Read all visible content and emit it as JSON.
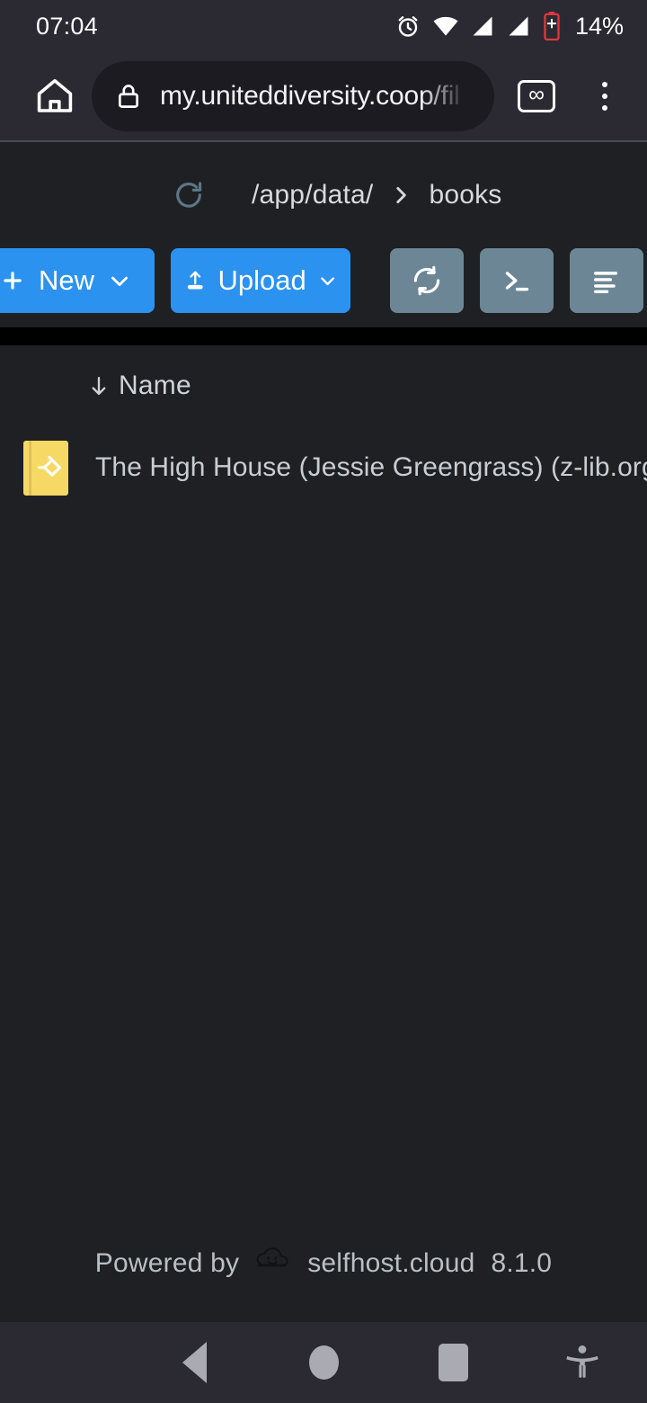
{
  "status_bar": {
    "clock": "07:04",
    "battery_percent": "14%",
    "battery_color": "#e8373c",
    "icons": [
      "alarm-clock-icon",
      "wifi-icon",
      "signal-bar-icon",
      "signal-bar-icon",
      "battery-low-icon"
    ]
  },
  "browser": {
    "home_icon": "home-icon",
    "security_icon": "lock-icon",
    "url": "my.uniteddiversity.coop/fil",
    "tab_count_label": "∞",
    "menu_icon": "more-vertical-icon"
  },
  "breadcrumb": {
    "reload_icon": "reload-icon",
    "reload_color": "#5b7786",
    "items": [
      "/app/data/",
      "books"
    ],
    "separator": "›"
  },
  "toolbar": {
    "new_label": "New",
    "new_icon": "plus-icon",
    "new_caret": "chevron-down-icon",
    "upload_label": "Upload",
    "upload_icon": "upload-icon",
    "upload_caret": "chevron-down-icon",
    "sync_icon": "sync-icon",
    "terminal_icon": "terminal-icon",
    "list_icon": "list-menu-icon",
    "accent_color": "#2b92f0",
    "secondary_color": "#6c8695"
  },
  "file_list": {
    "sort_column_label": "Name",
    "sort_direction_icon": "arrow-down-icon",
    "rows": [
      {
        "name": "The High House (Jessie Greengrass) (z-lib.org",
        "file_icon": "epub-book-icon",
        "icon_color": "#f6d964"
      }
    ]
  },
  "footer": {
    "prefix": "Powered by",
    "logo_icon": "cloud-smile-icon",
    "product": "selfhost.cloud",
    "version": "8.1.0"
  },
  "nav_bar": {
    "back_icon": "triangle-back-icon",
    "home_icon": "circle-home-icon",
    "recents_icon": "square-recents-icon",
    "accessibility_icon": "accessibility-icon"
  }
}
